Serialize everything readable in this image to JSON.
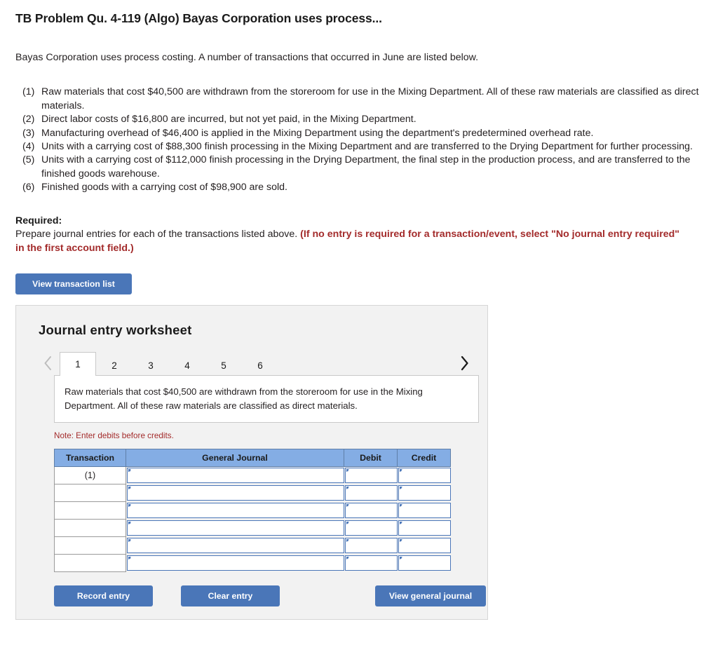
{
  "problem": {
    "title": "TB Problem Qu. 4-119 (Algo) Bayas Corporation uses process...",
    "intro": "Bayas Corporation uses process costing. A number of transactions that occurred in June are listed below.",
    "transactions": [
      {
        "num": "(1)",
        "text": "Raw materials that cost $40,500 are withdrawn from the storeroom for use in the Mixing Department. All of these raw materials are classified as direct materials."
      },
      {
        "num": "(2)",
        "text": "Direct labor costs of $16,800 are incurred, but not yet paid, in the Mixing Department."
      },
      {
        "num": "(3)",
        "text": "Manufacturing overhead of $46,400 is applied in the Mixing Department using the department's predetermined overhead rate."
      },
      {
        "num": "(4)",
        "text": "Units with a carrying cost of $88,300 finish processing in the Mixing Department and are transferred to the Drying Department for further processing."
      },
      {
        "num": "(5)",
        "text": "Units with a carrying cost of $112,000 finish processing in the Drying Department, the final step in the production process, and are transferred to the finished goods warehouse."
      },
      {
        "num": "(6)",
        "text": "Finished goods with a carrying cost of $98,900 are sold."
      }
    ]
  },
  "required": {
    "label": "Required:",
    "text": "Prepare journal entries for each of the transactions listed above. ",
    "emphasis": "(If no entry is required for a transaction/event, select \"No journal entry required\" in the first account field.)"
  },
  "buttons": {
    "view_transaction_list": "View transaction list",
    "record_entry": "Record entry",
    "clear_entry": "Clear entry",
    "view_general_journal": "View general journal"
  },
  "worksheet": {
    "title": "Journal entry worksheet",
    "tabs": [
      {
        "label": "1",
        "active": true
      },
      {
        "label": "2",
        "active": false
      },
      {
        "label": "3",
        "active": false
      },
      {
        "label": "4",
        "active": false
      },
      {
        "label": "5",
        "active": false
      },
      {
        "label": "6",
        "active": false
      }
    ],
    "prev_icon": "chevron-left-icon",
    "next_icon": "chevron-right-icon",
    "description": "Raw materials that cost $40,500 are withdrawn from the storeroom for use in the Mixing Department. All of these raw materials are classified as direct materials.",
    "note": "Note: Enter debits before credits.",
    "table": {
      "headers": [
        "Transaction",
        "General Journal",
        "Debit",
        "Credit"
      ],
      "rows": [
        {
          "transaction": "(1)",
          "general_journal": "",
          "debit": "",
          "credit": ""
        },
        {
          "transaction": "",
          "general_journal": "",
          "debit": "",
          "credit": ""
        },
        {
          "transaction": "",
          "general_journal": "",
          "debit": "",
          "credit": ""
        },
        {
          "transaction": "",
          "general_journal": "",
          "debit": "",
          "credit": ""
        },
        {
          "transaction": "",
          "general_journal": "",
          "debit": "",
          "credit": ""
        },
        {
          "transaction": "",
          "general_journal": "",
          "debit": "",
          "credit": ""
        }
      ]
    }
  },
  "colors": {
    "button_blue": "#4a76b8",
    "table_header_blue": "#84ade4",
    "note_red": "#a32b2b",
    "panel_gray": "#f2f2f2"
  }
}
